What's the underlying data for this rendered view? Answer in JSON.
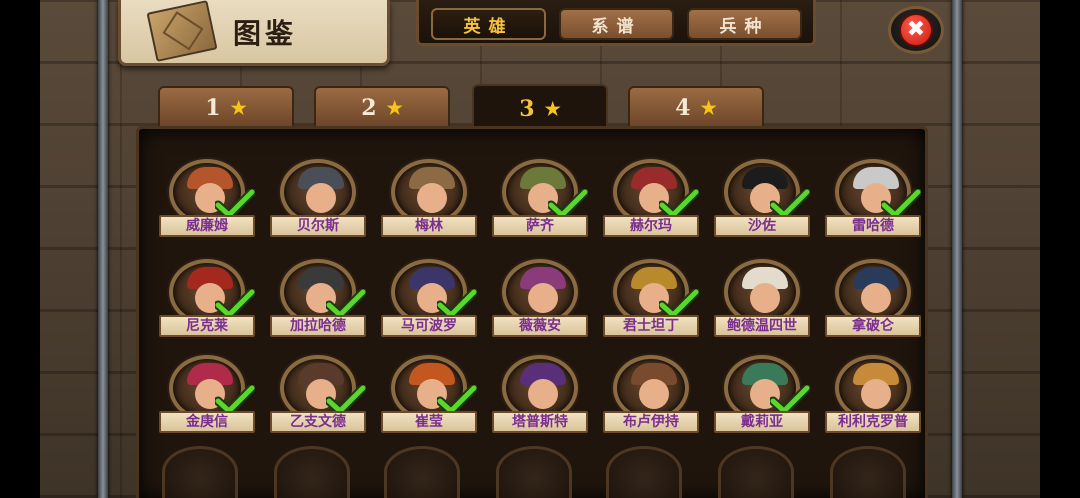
{
  "title": "图鉴",
  "top_tabs": [
    {
      "label": "英雄",
      "active": true
    },
    {
      "label": "系谱",
      "active": false
    },
    {
      "label": "兵种",
      "active": false
    }
  ],
  "close_icon": "close-icon",
  "star_tabs": [
    {
      "label": "1",
      "star": "★",
      "active": false
    },
    {
      "label": "2",
      "star": "★",
      "active": false
    },
    {
      "label": "3",
      "star": "★",
      "active": true
    },
    {
      "label": "4",
      "star": "★",
      "active": false
    }
  ],
  "heroes": [
    {
      "name": "威廉姆",
      "unlocked": true,
      "color": "#b5552c"
    },
    {
      "name": "贝尔斯",
      "unlocked": false,
      "color": "#4a4f57"
    },
    {
      "name": "梅林",
      "unlocked": false,
      "color": "#8b6a44"
    },
    {
      "name": "萨齐",
      "unlocked": true,
      "color": "#6b7a3a"
    },
    {
      "name": "赫尔玛",
      "unlocked": true,
      "color": "#9a2b2b"
    },
    {
      "name": "沙佐",
      "unlocked": true,
      "color": "#1c1c1c"
    },
    {
      "name": "雷哈德",
      "unlocked": true,
      "color": "#c9c9c9"
    },
    {
      "name": "尼克莱",
      "unlocked": true,
      "color": "#a5281f"
    },
    {
      "name": "加拉哈德",
      "unlocked": true,
      "color": "#3a3a3a"
    },
    {
      "name": "马可波罗",
      "unlocked": true,
      "color": "#3b3569"
    },
    {
      "name": "薇薇安",
      "unlocked": false,
      "color": "#8b3a7a"
    },
    {
      "name": "君士坦丁",
      "unlocked": true,
      "color": "#b98a2b"
    },
    {
      "name": "鲍德温四世",
      "unlocked": false,
      "color": "#e3dccc"
    },
    {
      "name": "拿破仑",
      "unlocked": false,
      "color": "#2a3a5a"
    },
    {
      "name": "金庚信",
      "unlocked": true,
      "color": "#b02b4a"
    },
    {
      "name": "乙支文德",
      "unlocked": true,
      "color": "#5a3a2a"
    },
    {
      "name": "崔莹",
      "unlocked": true,
      "color": "#c2571f"
    },
    {
      "name": "塔普斯特",
      "unlocked": false,
      "color": "#5a2f7a"
    },
    {
      "name": "布卢伊持",
      "unlocked": false,
      "color": "#7a4a2e"
    },
    {
      "name": "戴莉亚",
      "unlocked": true,
      "color": "#3a7a5a"
    },
    {
      "name": "利利克罗普",
      "unlocked": false,
      "color": "#c68a3a"
    }
  ]
}
